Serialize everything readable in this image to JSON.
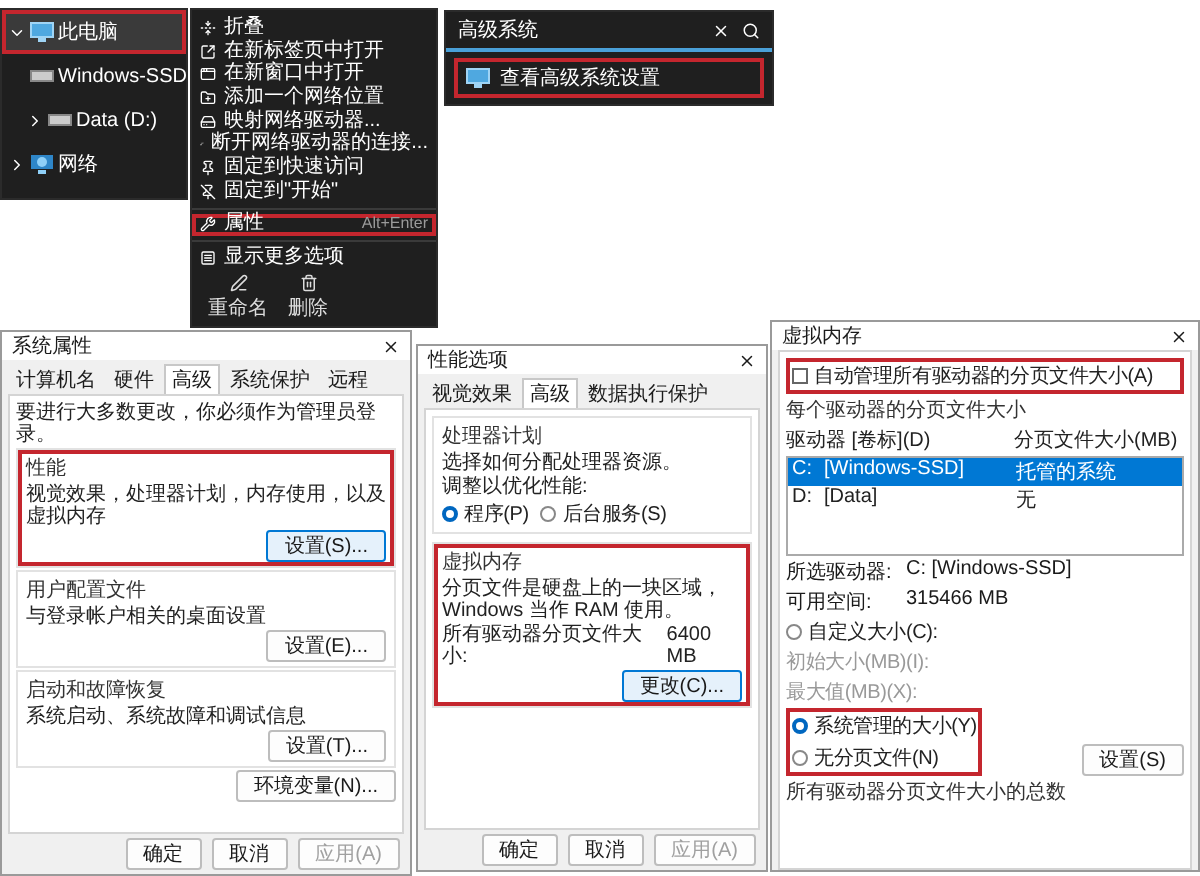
{
  "explorer_tree": {
    "items": [
      {
        "label": "此电脑",
        "kind": "pc",
        "expanded": true,
        "selected": true,
        "highlighted": true,
        "children": [
          {
            "label": "Windows-SSD",
            "kind": "drive",
            "expanded": false,
            "selected": false,
            "highlighted": false
          },
          {
            "label": "Data (D:)",
            "kind": "drive",
            "expanded": false,
            "selected": false,
            "highlighted": false
          }
        ]
      },
      {
        "label": "网络",
        "kind": "network",
        "expanded": false,
        "selected": false,
        "highlighted": false
      }
    ]
  },
  "context_menu": {
    "items": [
      {
        "label": "折叠",
        "highlighted": false
      },
      {
        "label": "在新标签页中打开",
        "highlighted": false
      },
      {
        "label": "在新窗口中打开",
        "highlighted": false
      },
      {
        "label": "添加一个网络位置",
        "highlighted": false
      },
      {
        "label": "映射网络驱动器...",
        "highlighted": false
      },
      {
        "label": "断开网络驱动器的连接...",
        "highlighted": false
      },
      {
        "label": "固定到快速访问",
        "highlighted": false
      },
      {
        "label": "固定到\"开始\"",
        "highlighted": false
      },
      {
        "label": "属性",
        "shortcut": "Alt+Enter",
        "highlighted": true
      },
      {
        "label": "显示更多选项",
        "highlighted": false
      }
    ],
    "footer_actions": [
      "重命名",
      "删除"
    ]
  },
  "search": {
    "value": "高级系统",
    "results": [
      {
        "label": "查看高级系统设置",
        "highlighted": true
      }
    ]
  },
  "system_properties": {
    "title": "系统属性",
    "tabs": [
      {
        "label": "计算机名",
        "selected": false
      },
      {
        "label": "硬件",
        "selected": false
      },
      {
        "label": "高级",
        "selected": true
      },
      {
        "label": "系统保护",
        "selected": false
      },
      {
        "label": "远程",
        "selected": false
      }
    ],
    "note": "要进行大多数更改，你必须作为管理员登录。",
    "groups": [
      {
        "title": "性能",
        "description": "视觉效果，处理器计划，内存使用，以及虚拟内存",
        "button": "设置(S)...",
        "highlighted": true
      },
      {
        "title": "用户配置文件",
        "description": "与登录帐户相关的桌面设置",
        "button": "设置(E)...",
        "highlighted": false
      },
      {
        "title": "启动和故障恢复",
        "description": "系统启动、系统故障和调试信息",
        "button": "设置(T)...",
        "highlighted": false
      }
    ],
    "env_button": "环境变量(N)...",
    "buttons": [
      {
        "label": "确定",
        "disabled": false
      },
      {
        "label": "取消",
        "disabled": false
      },
      {
        "label": "应用(A)",
        "disabled": true
      }
    ]
  },
  "performance_options": {
    "title": "性能选项",
    "tabs": [
      {
        "label": "视觉效果",
        "selected": false
      },
      {
        "label": "高级",
        "selected": true
      },
      {
        "label": "数据执行保护",
        "selected": false
      }
    ],
    "processor": {
      "title": "处理器计划",
      "description": "选择如何分配处理器资源。",
      "prompt": "调整以优化性能:",
      "options": [
        {
          "label": "程序(P)",
          "selected": true
        },
        {
          "label": "后台服务(S)",
          "selected": false
        }
      ]
    },
    "virtual_memory": {
      "title": "虚拟内存",
      "description": "分页文件是硬盘上的一块区域，Windows 当作 RAM 使用。",
      "size_label": "所有驱动器分页文件大小:",
      "size_value": "6400 MB",
      "button": "更改(C)...",
      "highlighted": true
    },
    "buttons": [
      {
        "label": "确定",
        "disabled": false
      },
      {
        "label": "取消",
        "disabled": false
      },
      {
        "label": "应用(A)",
        "disabled": true
      }
    ]
  },
  "virtual_memory": {
    "title": "虚拟内存",
    "auto_manage": {
      "label": "自动管理所有驱动器的分页文件大小(A)",
      "checked": false,
      "highlighted": true
    },
    "group_label": "每个驱动器的分页文件大小",
    "columns": [
      "驱动器 [卷标](D)",
      "分页文件大小(MB)"
    ],
    "drives": [
      {
        "drive": "C:",
        "volume": "[Windows-SSD]",
        "size": "托管的系统",
        "selected": true
      },
      {
        "drive": "D:",
        "volume": "[Data]",
        "size": "无",
        "selected": false
      }
    ],
    "selected_drive_label": "所选驱动器:",
    "selected_drive_value": "C: [Windows-SSD]",
    "free_space_label": "可用空间:",
    "free_space_value": "315466 MB",
    "custom_size": {
      "label": "自定义大小(C):",
      "selected": false,
      "fields": [
        "初始大小(MB)(I):",
        "最大值(MB)(X):"
      ]
    },
    "managed_options": {
      "highlighted": true,
      "options": [
        {
          "label": "系统管理的大小(Y)",
          "selected": true
        },
        {
          "label": "无分页文件(N)",
          "selected": false
        }
      ]
    },
    "set_button": "设置(S)",
    "total_label": "所有驱动器分页文件大小的总数"
  }
}
